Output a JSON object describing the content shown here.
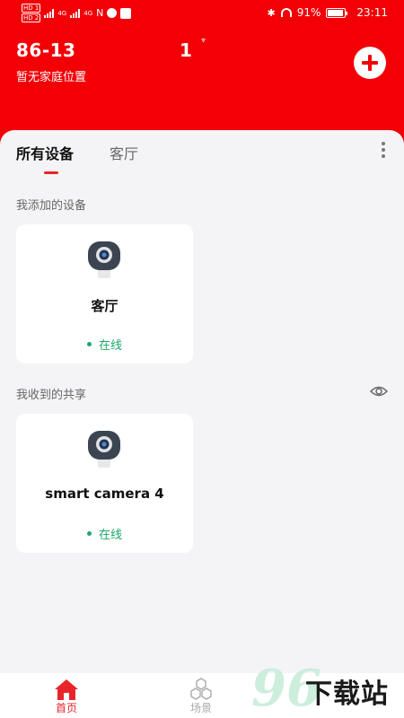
{
  "status_bar": {
    "sim1": "HD 1",
    "sim2": "HD 2",
    "net1": "4G",
    "net2": "4G",
    "battery_percent": "91%",
    "time": "23:11"
  },
  "header": {
    "account_prefix": "86-13",
    "account_suffix": "1",
    "location": "暂无家庭位置",
    "add_icon": "plus-icon"
  },
  "tabs": [
    {
      "label": "所有设备",
      "active": true
    },
    {
      "label": "客厅",
      "active": false
    }
  ],
  "sections": {
    "added_title": "我添加的设备",
    "shared_title": "我收到的共享"
  },
  "devices_added": [
    {
      "name": "客厅",
      "status": "在线",
      "icon": "camera-icon"
    }
  ],
  "devices_shared": [
    {
      "name": "smart camera 4",
      "status": "在线",
      "icon": "camera-icon"
    }
  ],
  "bottom_nav": [
    {
      "label": "首页",
      "icon": "home-icon",
      "active": true
    },
    {
      "label": "场景",
      "icon": "scene-icon",
      "active": false
    }
  ],
  "watermark": {
    "number": "96",
    "text": "下载站"
  },
  "colors": {
    "brand_red": "#f20006",
    "accent_red": "#e8242a",
    "online_green": "#1aa86a"
  }
}
